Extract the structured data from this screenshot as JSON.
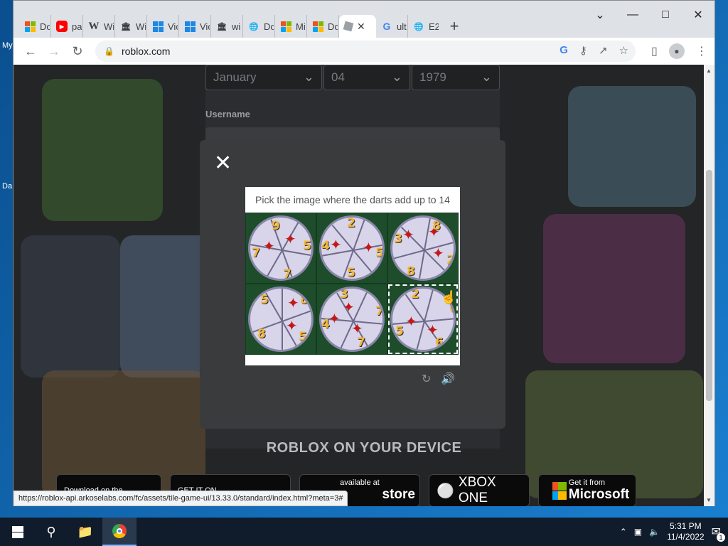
{
  "desktop": {
    "icon_labels": [
      "My",
      "Da"
    ]
  },
  "tabs": [
    {
      "label": "Do",
      "icon": "microsoft-icon"
    },
    {
      "label": "pa",
      "icon": "youtube-icon"
    },
    {
      "label": "Wi",
      "icon": "wikipedia-icon"
    },
    {
      "label": "Wi",
      "icon": "museum-icon"
    },
    {
      "label": "Vic",
      "icon": "windows-icon"
    },
    {
      "label": "Vic",
      "icon": "windows-icon"
    },
    {
      "label": "wi",
      "icon": "museum-icon"
    },
    {
      "label": "Do",
      "icon": "globe-icon"
    },
    {
      "label": "Mi",
      "icon": "microsoft-icon"
    },
    {
      "label": "Do",
      "icon": "microsoft-icon"
    },
    {
      "label": "",
      "icon": "roblox-icon",
      "active": true
    },
    {
      "label": "ult",
      "icon": "google-icon"
    },
    {
      "label": "E2",
      "icon": "globe-icon"
    }
  ],
  "toolbar": {
    "url": "roblox.com"
  },
  "form": {
    "month": "January",
    "day": "04",
    "year": "1979",
    "username_label": "Username"
  },
  "captcha": {
    "prompt": "Pick the image where the darts add up to 14",
    "tiles": [
      {
        "numbers": [
          "9",
          "7",
          "5",
          "7"
        ]
      },
      {
        "numbers": [
          "2",
          "4",
          "5",
          "5"
        ]
      },
      {
        "numbers": [
          "3",
          "8",
          "2",
          "8"
        ]
      },
      {
        "numbers": [
          "5",
          "8",
          "8",
          "5"
        ]
      },
      {
        "numbers": [
          "3",
          "4",
          "7",
          "7"
        ]
      },
      {
        "numbers": [
          "2",
          "6",
          "5",
          "6"
        ],
        "selected": true
      }
    ]
  },
  "promo": {
    "title": "ROBLOX ON YOUR DEVICE",
    "stores": [
      {
        "line1": "Download on the",
        "line2": ""
      },
      {
        "line1": "GET IT ON",
        "line2": ""
      },
      {
        "line1": "available at",
        "line2": "store"
      },
      {
        "line1": "",
        "line2": "XBOX ONE"
      },
      {
        "line1": "Get it from",
        "line2": "Microsoft"
      }
    ]
  },
  "status_url": "https://roblox-api.arkoselabs.com/fc/assets/tile-game-ui/13.33.0/standard/index.html?meta=3#",
  "taskbar": {
    "time": "5:31 PM",
    "date": "11/4/2022",
    "notifications": "1"
  }
}
